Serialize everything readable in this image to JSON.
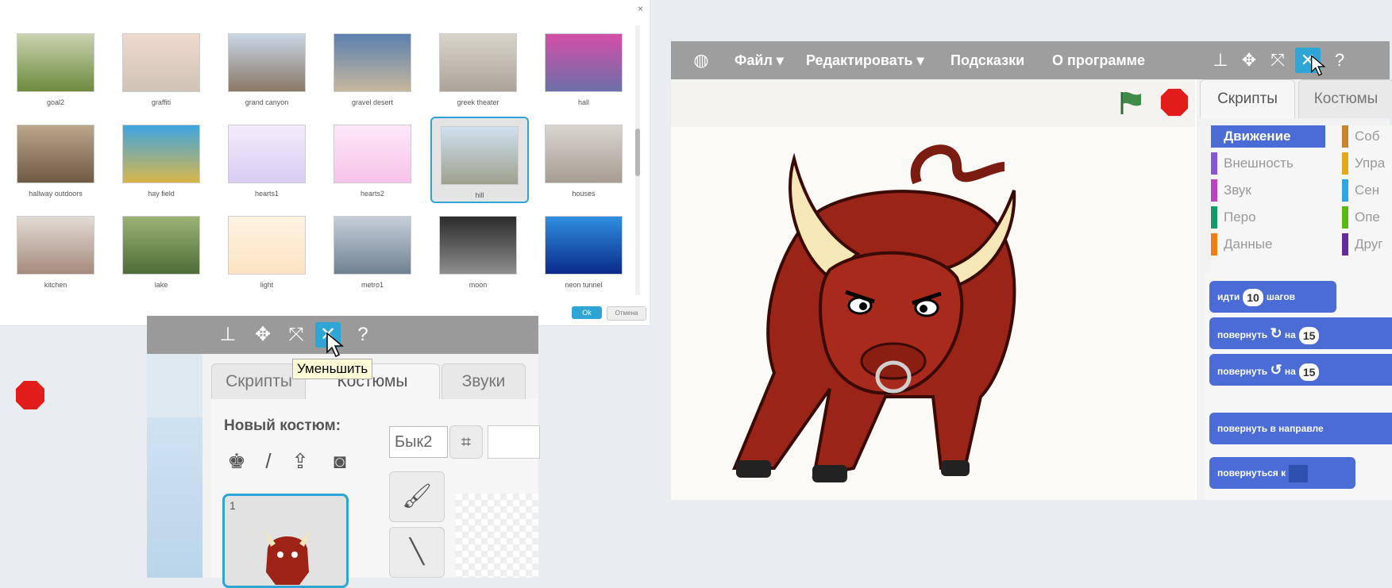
{
  "library": {
    "close": "×",
    "items": [
      {
        "name": "goal2",
        "c1": "#6d8a3d",
        "c2": "#c9d3b0"
      },
      {
        "name": "graffiti",
        "c1": "#cfc3b6",
        "c2": "#f0d9cf"
      },
      {
        "name": "grand canyon",
        "c1": "#8a7866",
        "c2": "#c8d6e6"
      },
      {
        "name": "gravel desert",
        "c1": "#c7b89e",
        "c2": "#5a7fae"
      },
      {
        "name": "greek theater",
        "c1": "#aaa39a",
        "c2": "#d9d4cb"
      },
      {
        "name": "hall",
        "c1": "#6c6fa8",
        "c2": "#d54ea8"
      },
      {
        "name": "hallway outdoors",
        "c1": "#6f5a45",
        "c2": "#b9a68b"
      },
      {
        "name": "hay field",
        "c1": "#d8b64a",
        "c2": "#3fa5e0"
      },
      {
        "name": "hearts1",
        "c1": "#d9ccf2",
        "c2": "#f3ecfb"
      },
      {
        "name": "hearts2",
        "c1": "#f7c3ea",
        "c2": "#fde8f7"
      },
      {
        "name": "hill",
        "c1": "#9fa08d",
        "c2": "#cfe0ef"
      },
      {
        "name": "houses",
        "c1": "#a69c93",
        "c2": "#dad5cf"
      },
      {
        "name": "kitchen",
        "c1": "#a48a7b",
        "c2": "#e2dcd6"
      },
      {
        "name": "lake",
        "c1": "#4d6d37",
        "c2": "#9db275"
      },
      {
        "name": "light",
        "c1": "#fbe3c2",
        "c2": "#fff3e2"
      },
      {
        "name": "metro1",
        "c1": "#6f8192",
        "c2": "#c6cfd9"
      },
      {
        "name": "moon",
        "c1": "#8e8e8e",
        "c2": "#2b2b2b"
      },
      {
        "name": "neon tunnel",
        "c1": "#0a2a8a",
        "c2": "#2f8fe0"
      }
    ],
    "ok": "Ok",
    "cancel": "Отмена"
  },
  "editor": {
    "toolbar_icons": [
      "stamp-icon",
      "grow-icon",
      "fullscreen-icon",
      "shrink-icon",
      "help-icon"
    ],
    "tooltip": "Уменьшить",
    "tabs": [
      "Скрипты",
      "Костюмы",
      "Звуки"
    ],
    "new_costume_label": "Новый костюм:",
    "costume_number": "1",
    "costume_name": "Бык2"
  },
  "scratch": {
    "menu": [
      "Файл ▾",
      "Редактировать ▾",
      "Подсказки",
      "О программе"
    ],
    "tabs": [
      "Скрипты",
      "Костюмы"
    ],
    "categories_left": [
      {
        "label": "Движение",
        "color": "#4a6cd4",
        "selected": true
      },
      {
        "label": "Внешность",
        "color": "#8a55d7"
      },
      {
        "label": "Звук",
        "color": "#bb42c3"
      },
      {
        "label": "Перо",
        "color": "#0e9a6c"
      },
      {
        "label": "Данные",
        "color": "#ee7d16"
      }
    ],
    "categories_right": [
      {
        "label": "Соб",
        "color": "#c88330"
      },
      {
        "label": "Упра",
        "color": "#e1a91a"
      },
      {
        "label": "Сен",
        "color": "#2ca5e2"
      },
      {
        "label": "Опе",
        "color": "#5cb712"
      },
      {
        "label": "Друг",
        "color": "#632d99"
      }
    ],
    "blocks": {
      "move": {
        "pre": "идти",
        "num": "10",
        "post": "шагов"
      },
      "turn_right": {
        "pre": "повернуть",
        "arrow": "↻",
        "mid": "на",
        "num": "15"
      },
      "turn_left": {
        "pre": "повернуть",
        "arrow": "↺",
        "mid": "на",
        "num": "15"
      },
      "point_dir": "повернуть в направле",
      "point_to": "повернуться к"
    }
  }
}
